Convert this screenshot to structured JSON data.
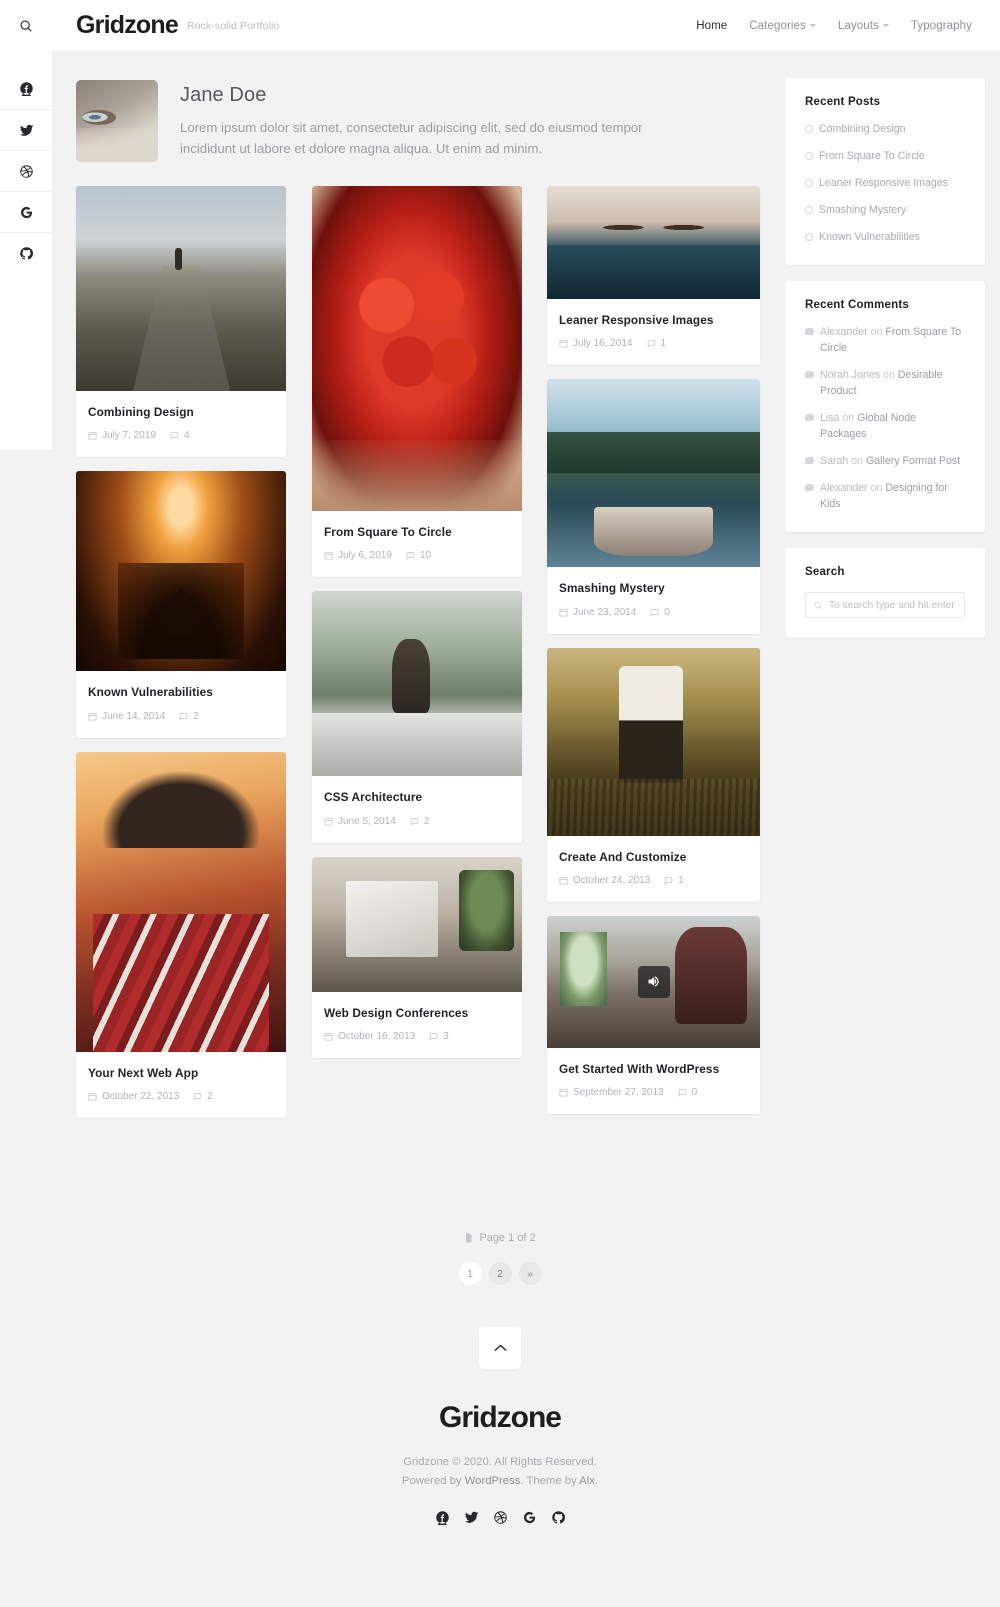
{
  "header": {
    "logo": "Gridzone",
    "tagline": "Rock-solid Portfolio",
    "nav": [
      {
        "label": "Home",
        "has_caret": false,
        "active": true
      },
      {
        "label": "Categories",
        "has_caret": true,
        "active": false
      },
      {
        "label": "Layouts",
        "has_caret": true,
        "active": false
      },
      {
        "label": "Typography",
        "has_caret": false,
        "active": false
      }
    ],
    "search_icon": "search-icon"
  },
  "social_rail": [
    {
      "name": "facebook-icon",
      "label": "Facebook"
    },
    {
      "name": "twitter-icon",
      "label": "Twitter"
    },
    {
      "name": "dribbble-icon",
      "label": "Dribbble"
    },
    {
      "name": "google-icon",
      "label": "Google"
    },
    {
      "name": "github-icon",
      "label": "GitHub"
    }
  ],
  "author": {
    "name": "Jane Doe",
    "description": "Lorem ipsum dolor sit amet, consectetur adipiscing elit, sed do eiusmod tempor incididunt ut labore et dolore magna aliqua. Ut enim ad minim."
  },
  "posts": {
    "column_1": [
      {
        "title": "Combining Design",
        "date": "July 7, 2019",
        "comments": "4"
      },
      {
        "title": "Known Vulnerabilities",
        "date": "June 14, 2014",
        "comments": "2"
      },
      {
        "title": "Your Next Web App",
        "date": "October 22, 2013",
        "comments": "2"
      }
    ],
    "column_2": [
      {
        "title": "From Square To Circle",
        "date": "July 6, 2019",
        "comments": "10"
      },
      {
        "title": "CSS Architecture",
        "date": "June 5, 2014",
        "comments": "2"
      },
      {
        "title": "Web Design Conferences",
        "date": "October 16, 2013",
        "comments": "3"
      }
    ],
    "column_3": [
      {
        "title": "Leaner Responsive Images",
        "date": "July 16, 2014",
        "comments": "1"
      },
      {
        "title": "Smashing Mystery",
        "date": "June 23, 2014",
        "comments": "0"
      },
      {
        "title": "Create And Customize",
        "date": "October 24, 2013",
        "comments": "1"
      },
      {
        "title": "Get Started With WordPress",
        "date": "September 27, 2013",
        "comments": "0",
        "format_badge": "audio-icon"
      }
    ]
  },
  "sidebar": {
    "recent_posts": {
      "title": "Recent Posts",
      "items": [
        "Combining Design",
        "From Square To Circle",
        "Leaner Responsive Images",
        "Smashing Mystery",
        "Known Vulnerabilities"
      ]
    },
    "recent_comments": {
      "title": "Recent Comments",
      "items": [
        {
          "author": "Alexander",
          "on": "on",
          "post": "From Square To Circle"
        },
        {
          "author": "Norah Jones",
          "on": "on",
          "post": "Desirable Product"
        },
        {
          "author": "Lisa",
          "on": "on",
          "post": "Global Node Packages"
        },
        {
          "author": "Sarah",
          "on": "on",
          "post": "Gallery Format Post"
        },
        {
          "author": "Alexander",
          "on": "on",
          "post": "Designing for Kids"
        }
      ]
    },
    "search": {
      "title": "Search",
      "placeholder": "To search type and hit enter",
      "value": ""
    }
  },
  "pagination": {
    "indicator": "Page 1 of 2",
    "pages": [
      {
        "label": "1",
        "state": "normal"
      },
      {
        "label": "2",
        "state": "current"
      },
      {
        "label": "»",
        "state": "next"
      }
    ]
  },
  "footer": {
    "logo": "Gridzone",
    "copyright": "Gridzone © 2020. All Rights Reserved.",
    "powered_prefix": "Powered by ",
    "powered_link": "WordPress",
    "powered_middle": ". Theme by ",
    "theme_link": "Alx",
    "powered_suffix": ".",
    "social": [
      {
        "name": "facebook-icon"
      },
      {
        "name": "twitter-icon"
      },
      {
        "name": "dribbble-icon"
      },
      {
        "name": "google-icon"
      },
      {
        "name": "github-icon"
      }
    ],
    "back_to_top": "chevron-up-icon"
  },
  "colors": {
    "background": "#f2f2f2",
    "card": "#ffffff",
    "text": "#1f2124",
    "muted": "#a8abaf"
  }
}
